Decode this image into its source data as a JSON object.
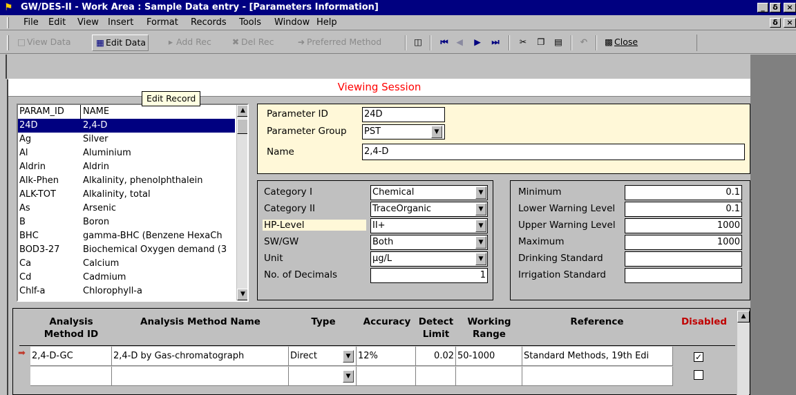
{
  "window": {
    "title": "GW/DES-II - Work Area : Sample Data entry - [Parameters Information]",
    "min": "_",
    "max": "□",
    "close": "×",
    "restore": "ẟ"
  },
  "menu": [
    "File",
    "Edit",
    "View",
    "Insert",
    "Format",
    "Records",
    "Tools",
    "Window",
    "Help"
  ],
  "toolbar": {
    "view_data": "View Data",
    "edit_data": "Edit Data",
    "add_rec": "Add Rec",
    "del_rec": "Del Rec",
    "preferred_method": "Preferred Method",
    "close": "Close"
  },
  "session": {
    "status": "Viewing Session"
  },
  "tooltip": "Edit Record",
  "param_list": {
    "headers": [
      "PARAM_ID",
      "NAME"
    ],
    "rows": [
      [
        "24D",
        "2,4-D"
      ],
      [
        "Ag",
        "Silver"
      ],
      [
        "Al",
        "Aluminium"
      ],
      [
        "Aldrin",
        "Aldrin"
      ],
      [
        "Alk-Phen",
        "Alkalinity, phenolphthalein"
      ],
      [
        "ALK-TOT",
        "Alkalinity, total"
      ],
      [
        "As",
        "Arsenic"
      ],
      [
        "B",
        "Boron"
      ],
      [
        "BHC",
        "gamma-BHC (Benzene HexaCh"
      ],
      [
        "BOD3-27",
        "Biochemical Oxygen demand (3"
      ],
      [
        "Ca",
        "Calcium"
      ],
      [
        "Cd",
        "Cadmium"
      ],
      [
        "Chlf-a",
        "Chlorophyll-a"
      ]
    ]
  },
  "param_info": {
    "id_label": "Parameter ID",
    "id_value": "24D",
    "group_label": "Parameter Group",
    "group_value": "PST",
    "name_label": "Name",
    "name_value": "2,4-D"
  },
  "categories": {
    "cat1_label": "Category I",
    "cat1_value": "Chemical",
    "cat2_label": "Category II",
    "cat2_value": "TraceOrganic",
    "hp_label": "HP-Level",
    "hp_value": "II+",
    "swgw_label": "SW/GW",
    "swgw_value": "Both",
    "unit_label": "Unit",
    "unit_value": "µg/L",
    "dec_label": "No. of Decimals",
    "dec_value": "1"
  },
  "limits": {
    "min_label": "Minimum",
    "min_value": "0.1",
    "lwl_label": "Lower Warning Level",
    "lwl_value": "0.1",
    "uwl_label": "Upper Warning Level",
    "uwl_value": "1000",
    "max_label": "Maximum",
    "max_value": "1000",
    "drink_label": "Drinking Standard",
    "drink_value": "",
    "irr_label": "Irrigation Standard",
    "irr_value": ""
  },
  "grid": {
    "headers": {
      "method_id": "Analysis Method ID",
      "method_name": "Analysis Method Name",
      "type": "Type",
      "accuracy": "Accuracy",
      "detect": "Detect Limit",
      "working": "Working Range",
      "reference": "Reference",
      "disabled": "Disabled"
    },
    "row1": {
      "method_id": "2,4-D-GC",
      "method_name": "2,4-D by Gas-chromatograph",
      "type": "Direct",
      "accuracy": "12%",
      "detect": "0.02",
      "working": "50-1000",
      "reference": "Standard Methods, 19th Edi",
      "disabled": true
    },
    "row2": {
      "disabled": false
    },
    "record_pointer": "➡"
  },
  "colors": {
    "title_bar": "#000080",
    "session_text": "#ff0000",
    "disabled_header": "#c00000",
    "panel_bg": "#fff8d8",
    "selection": "#000080"
  }
}
